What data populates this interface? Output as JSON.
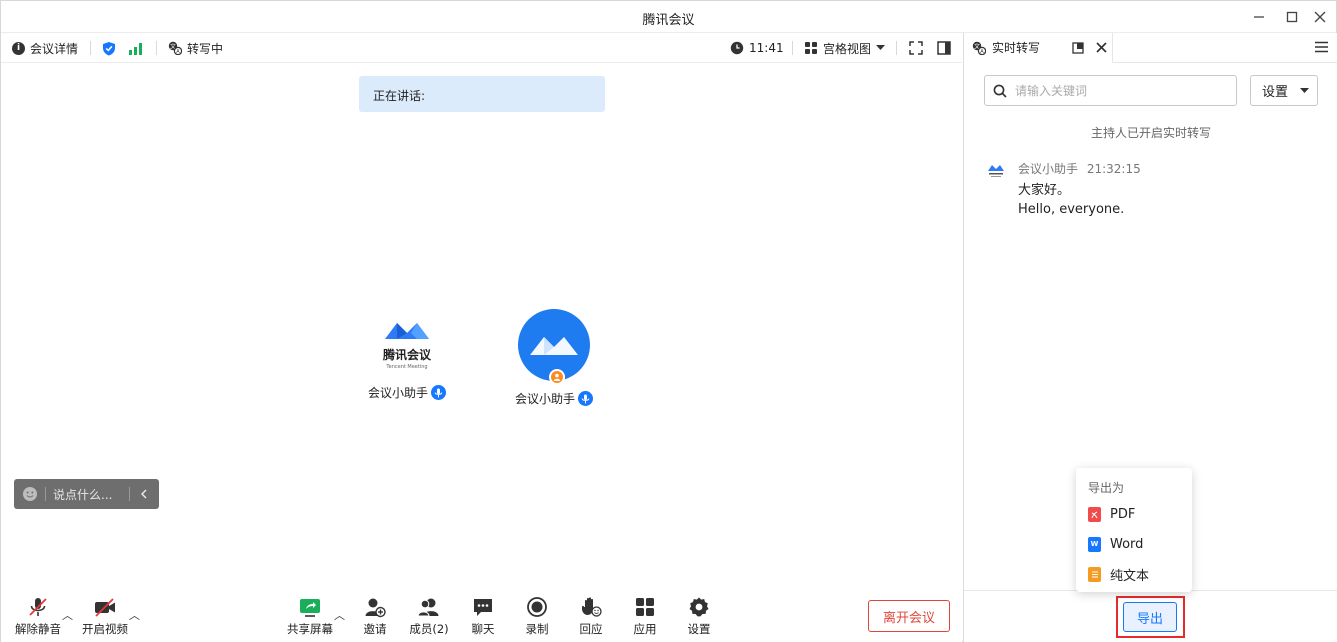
{
  "window": {
    "title": "腾讯会议"
  },
  "toolbar": {
    "meeting_info": "会议详情",
    "transcribing": "转写中",
    "time": "11:41",
    "view_mode": "宫格视图"
  },
  "main": {
    "speaking_label": "正在讲话:",
    "participants": [
      {
        "name": "会议小助手",
        "logo_text": "腾讯会议",
        "logo_sub": "Tencent Meeting"
      },
      {
        "name": "会议小助手"
      }
    ],
    "chat_placeholder": "说点什么..."
  },
  "controls": {
    "unmute": "解除静音",
    "start_video": "开启视频",
    "share_screen": "共享屏幕",
    "invite": "邀请",
    "members": "成员(2)",
    "chat": "聊天",
    "record": "录制",
    "reactions": "回应",
    "apps": "应用",
    "settings": "设置",
    "leave": "离开会议"
  },
  "panel": {
    "tab_title": "实时转写",
    "search_placeholder": "请输入关键词",
    "settings_label": "设置",
    "notice": "主持人已开启实时转写",
    "message": {
      "sender": "会议小助手",
      "time": "21:32:15",
      "lines": [
        "大家好。",
        "Hello, everyone."
      ]
    },
    "export_button": "导出"
  },
  "export_menu": {
    "header": "导出为",
    "items": [
      {
        "label": "PDF",
        "color": "#f04c4c",
        "badge": ""
      },
      {
        "label": "Word",
        "color": "#1677ff",
        "badge": "W"
      },
      {
        "label": "纯文本",
        "color": "#f59a23",
        "badge": ""
      }
    ]
  },
  "colors": {
    "accent": "#1677ff",
    "danger": "#e0453a",
    "signal": "#1aad5a"
  }
}
